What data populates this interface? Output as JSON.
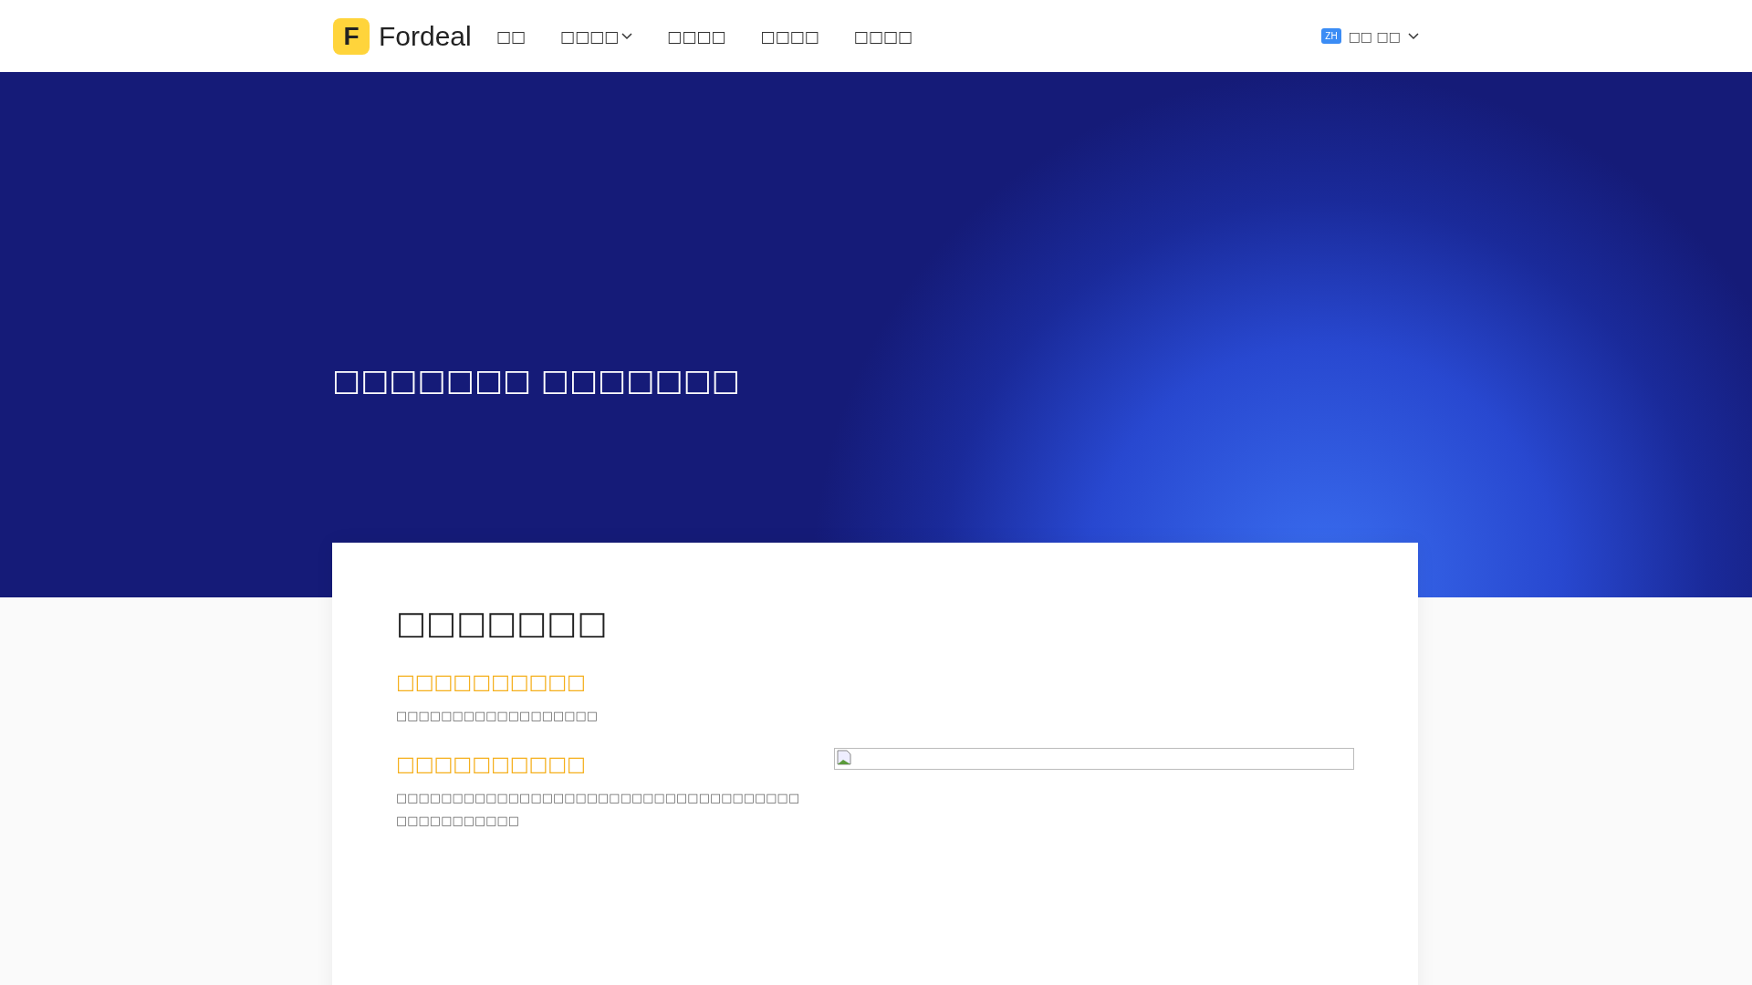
{
  "header": {
    "logo_letter": "F",
    "logo_text": "Fordeal",
    "nav": [
      {
        "label": "□□",
        "dropdown": false
      },
      {
        "label": "□□□□",
        "dropdown": true
      },
      {
        "label": "□□□□",
        "dropdown": false
      },
      {
        "label": "□□□□",
        "dropdown": false
      },
      {
        "label": "□□□□",
        "dropdown": false
      }
    ],
    "language": {
      "badge": "ZH",
      "label": "□□ □□"
    }
  },
  "hero": {
    "title": "□□□□□□□ □□□□□□□"
  },
  "card": {
    "title": "□□□□□□□",
    "sections": [
      {
        "heading": "□□□□□□□□□□",
        "text": "□□□□□□□□□□□□□□□□□□"
      },
      {
        "heading": "□□□□□□□□□□",
        "text": "□□□□□□□□□□□□□□□□□□□□□□□□□□□□□□□□□□□□□□□□□□□□□□□"
      }
    ]
  }
}
